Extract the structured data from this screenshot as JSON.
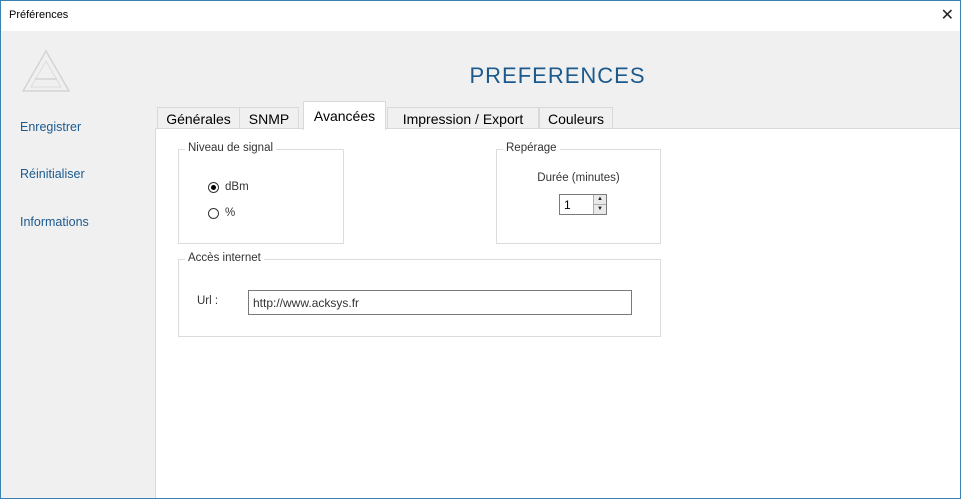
{
  "window": {
    "title": "Préférences"
  },
  "sidebar": {
    "items": [
      {
        "label": "Enregistrer"
      },
      {
        "label": "Réinitialiser"
      },
      {
        "label": "Informations"
      }
    ]
  },
  "header": {
    "title": "PREFERENCES"
  },
  "tabs": [
    {
      "label": "Générales",
      "active": false
    },
    {
      "label": "SNMP",
      "active": false
    },
    {
      "label": "Avancées",
      "active": true
    },
    {
      "label": "Impression / Export",
      "active": false
    },
    {
      "label": "Couleurs",
      "active": false
    }
  ],
  "signal_group": {
    "legend": "Niveau de signal",
    "options": [
      {
        "label": "dBm",
        "checked": true
      },
      {
        "label": "%",
        "checked": false
      }
    ]
  },
  "reperage_group": {
    "legend": "Repérage",
    "duration_label": "Durée (minutes)",
    "duration_value": "1"
  },
  "internet_group": {
    "legend": "Accès internet",
    "url_label": "Url :",
    "url_value": "http://www.acksys.fr"
  },
  "colors": {
    "accent": "#1c5a8e",
    "border": "#3c7fb1",
    "panel_bg": "#f0f0f0"
  }
}
